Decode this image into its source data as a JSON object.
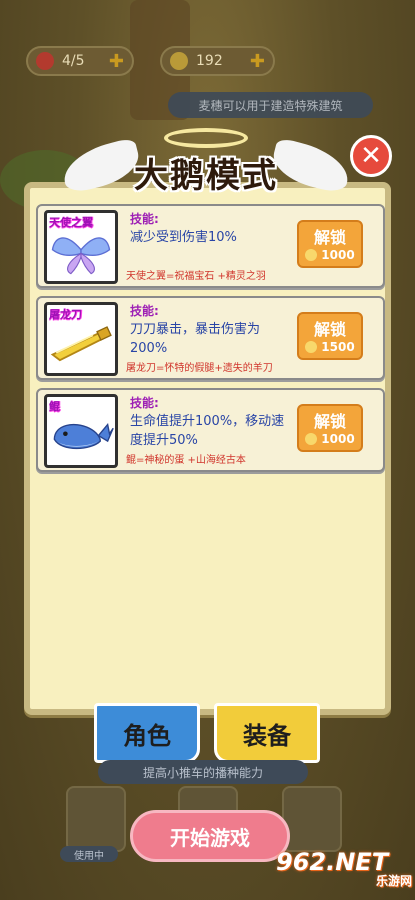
{
  "hud": {
    "lives": "4/5",
    "grain": "192",
    "hint": "麦穗可以用于建造特殊建筑"
  },
  "modal": {
    "title": "大鹅模式",
    "close_label": "✕",
    "skill_heading": "技能:",
    "unlock_label": "解锁",
    "cards": [
      {
        "name": "天使之翼",
        "desc": "减少受到伤害10%",
        "recipe": "天使之翼=祝福宝石 +精灵之羽",
        "cost": "1000"
      },
      {
        "name": "屠龙刀",
        "desc": "刀刀暴击，暴击伤害为200%",
        "recipe": "屠龙刀=怀特的假腿+遗失的羊刀",
        "cost": "1500"
      },
      {
        "name": "鲲",
        "desc": "生命值提升100%，移动速度提升50%",
        "recipe": "鲲=神秘的蛋 +山海经古本",
        "cost": "1000"
      }
    ]
  },
  "tabs": {
    "role": "角色",
    "equip": "装备"
  },
  "promo": "提高小推车的播种能力",
  "in_use": "使用中",
  "start_button": "开始游戏",
  "watermark": {
    "main": "962.NET",
    "sub": "乐游网"
  },
  "colors": {
    "panel_bg": "#f8f0bf",
    "unlock_btn": "#f3a53a",
    "close_btn": "#e64a3c",
    "start_btn": "#ef7c8d",
    "tab_role": "#3d8cd8",
    "tab_equip": "#f2cc3a"
  }
}
